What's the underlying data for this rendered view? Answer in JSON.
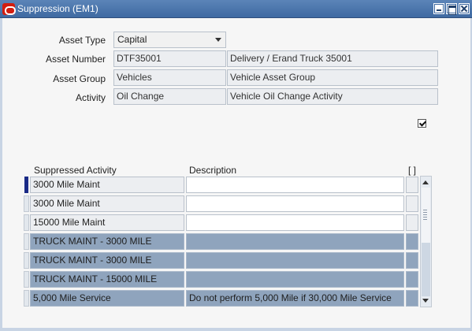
{
  "window": {
    "title": "Suppression (EM1)"
  },
  "form": {
    "asset_type": {
      "label": "Asset Type",
      "value": "Capital"
    },
    "asset_number": {
      "label": "Asset Number",
      "value": "DTF35001",
      "description": "Delivery / Erand Truck 35001"
    },
    "asset_group": {
      "label": "Asset Group",
      "value": "Vehicles",
      "description": "Vehicle Asset Group"
    },
    "activity": {
      "label": "Activity",
      "value": "Oil Change",
      "description": "Vehicle Oil Change Activity"
    },
    "checkbox_checked": true
  },
  "grid": {
    "headers": {
      "activity": "Suppressed Activity",
      "description": "Description",
      "extra": "[ ]"
    },
    "rows": [
      {
        "activity": "3000 Mile Maint",
        "description": ""
      },
      {
        "activity": "3000 Mile Maint",
        "description": ""
      },
      {
        "activity": "15000 Mile Maint",
        "description": ""
      },
      {
        "activity": "TRUCK MAINT - 3000 MILE",
        "description": ""
      },
      {
        "activity": "TRUCK MAINT - 3000 MILE",
        "description": ""
      },
      {
        "activity": "TRUCK MAINT - 15000 MILE",
        "description": ""
      },
      {
        "activity": "5,000 Mile Service",
        "description": "Do not perform 5,000 Mile if 30,000 Mile Service"
      }
    ]
  },
  "colors": {
    "titlebar": "#3f6aa2",
    "selected_row": "#8fa4bd",
    "current_indicator": "#1a2a86"
  }
}
